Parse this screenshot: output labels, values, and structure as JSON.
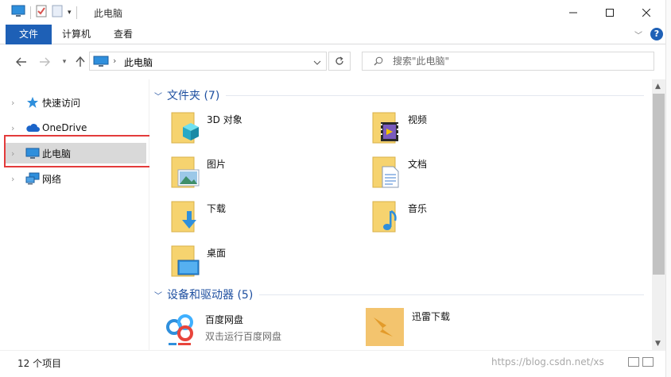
{
  "window": {
    "title": "此电脑"
  },
  "ribbon": {
    "tabs": [
      {
        "label": "文件"
      },
      {
        "label": "计算机"
      },
      {
        "label": "查看"
      }
    ]
  },
  "address": {
    "path": "此电脑",
    "search_placeholder": "搜索\"此电脑\""
  },
  "nav_pane": {
    "items": [
      {
        "label": "快速访问",
        "icon": "star-icon"
      },
      {
        "label": "OneDrive",
        "icon": "cloud-icon"
      },
      {
        "label": "此电脑",
        "icon": "computer-icon",
        "selected": true
      },
      {
        "label": "网络",
        "icon": "network-icon"
      }
    ]
  },
  "folders": {
    "header": "文件夹 (7)",
    "items": [
      {
        "label": "3D 对象",
        "icon": "3d-objects-folder-icon"
      },
      {
        "label": "视频",
        "icon": "videos-folder-icon"
      },
      {
        "label": "图片",
        "icon": "pictures-folder-icon"
      },
      {
        "label": "文档",
        "icon": "documents-folder-icon"
      },
      {
        "label": "下载",
        "icon": "downloads-folder-icon"
      },
      {
        "label": "音乐",
        "icon": "music-folder-icon"
      },
      {
        "label": "桌面",
        "icon": "desktop-folder-icon"
      }
    ]
  },
  "devices": {
    "header": "设备和驱动器 (5)",
    "items": [
      {
        "label": "百度网盘",
        "sublabel": "双击运行百度网盘",
        "icon": "baidu-netdisk-icon"
      },
      {
        "label": "迅雷下载",
        "icon": "xunlei-download-icon"
      }
    ]
  },
  "status": {
    "item_count": "12 个项目",
    "watermark": "https://blog.csdn.net/xs"
  },
  "colors": {
    "accent": "#1e60b6",
    "group_header": "#1e4fa0",
    "folder_yellow": "#f6d36f",
    "selection_box": "#e33b3b"
  }
}
